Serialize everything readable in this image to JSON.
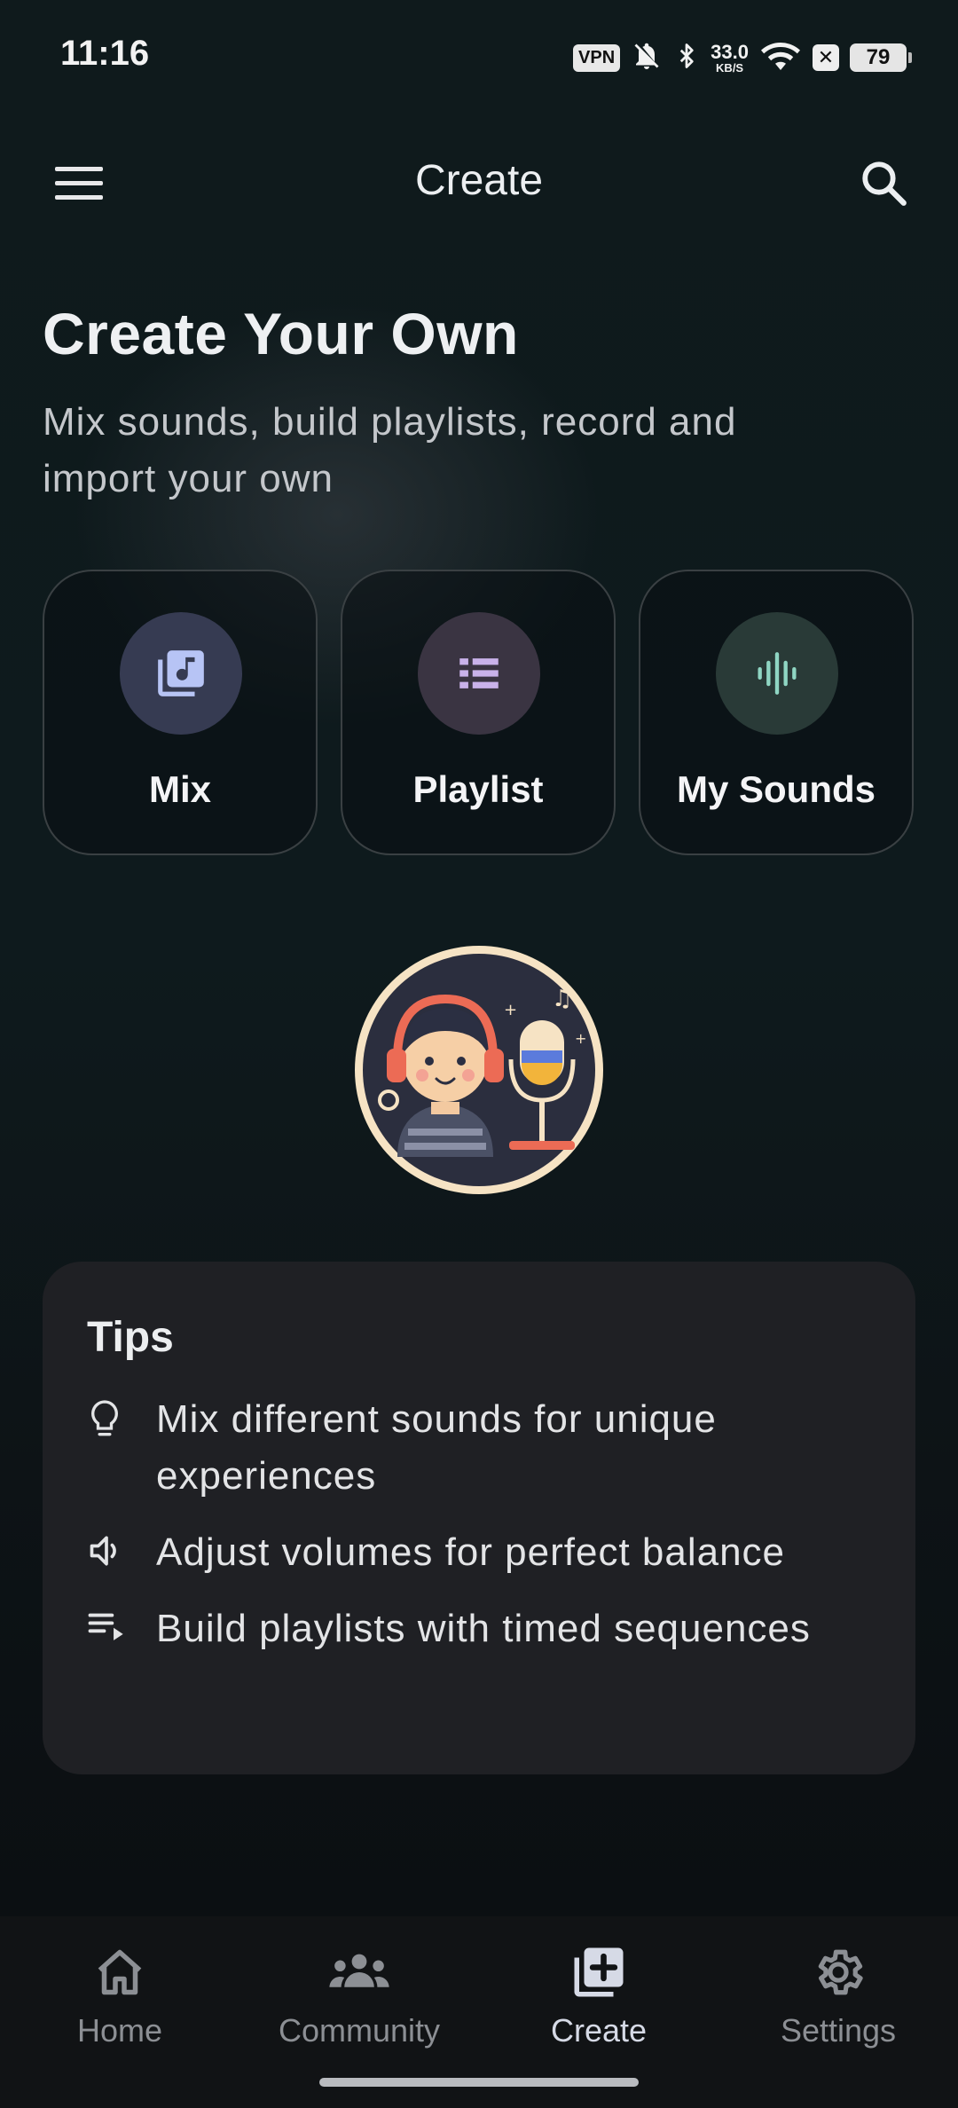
{
  "status_bar": {
    "time": "11:16",
    "vpn": "VPN",
    "speed_value": "33.0",
    "speed_unit": "KB/S",
    "battery": "79",
    "icons": [
      "vpn-icon",
      "bell-off-icon",
      "bluetooth-icon",
      "wifi-icon",
      "x-notification-icon",
      "battery-icon"
    ]
  },
  "app_bar": {
    "title": "Create",
    "menu_icon": "hamburger-menu-icon",
    "search_icon": "search-icon"
  },
  "hero": {
    "title": "Create Your Own",
    "subtitle": "Mix sounds, build playlists, record and import your own"
  },
  "actions": [
    {
      "label": "Mix",
      "icon": "music-library-icon",
      "color": "#b7c4f5"
    },
    {
      "label": "Playlist",
      "icon": "list-icon",
      "color": "#c9b2ea"
    },
    {
      "label": "My Sounds",
      "icon": "waveform-icon",
      "color": "#8fd6c3"
    }
  ],
  "tips": {
    "title": "Tips",
    "items": [
      {
        "icon": "lightbulb-icon",
        "text": "Mix different sounds for unique experiences"
      },
      {
        "icon": "volume-icon",
        "text": "Adjust volumes for perfect balance"
      },
      {
        "icon": "playlist-play-icon",
        "text": "Build playlists with timed sequences"
      }
    ]
  },
  "bottom_nav": {
    "items": [
      {
        "label": "Home",
        "icon": "home-icon",
        "active": false
      },
      {
        "label": "Community",
        "icon": "people-icon",
        "active": false
      },
      {
        "label": "Create",
        "icon": "add-box-icon",
        "active": true
      },
      {
        "label": "Settings",
        "icon": "gear-icon",
        "active": false
      }
    ]
  },
  "colors": {
    "background": "#0e1a1d",
    "card": "#1f2024",
    "nav_active": "#d6dae6",
    "nav_inactive": "#8c8f94"
  }
}
